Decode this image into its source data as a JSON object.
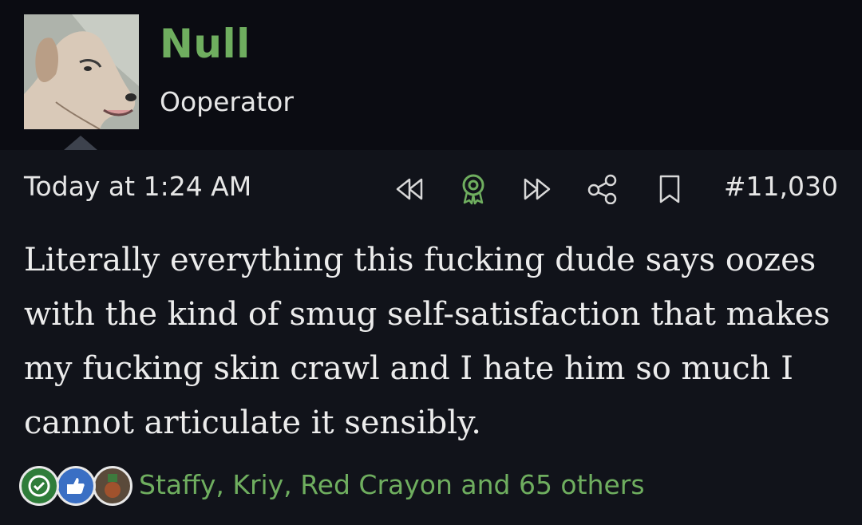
{
  "author": {
    "name": "Null",
    "title": "Ooperator"
  },
  "post": {
    "date": "Today at 1:24 AM",
    "number": "#11,030",
    "body": "Literally everything this fucking dude says oozes with the kind of smug self-satisfaction that makes my fucking skin crawl and I hate him so much I cannot articulate it sensibly."
  },
  "actions": [
    {
      "icon": "rewind-icon"
    },
    {
      "icon": "award-icon"
    },
    {
      "icon": "fast-forward-icon"
    },
    {
      "icon": "share-icon"
    },
    {
      "icon": "bookmark-icon"
    }
  ],
  "reactions": {
    "icons": [
      "check-reaction-icon",
      "thumbs-up-reaction-icon",
      "medal-reaction-icon"
    ],
    "summary": "Staffy, Kriy, Red Crayon and 65 others"
  },
  "colors": {
    "accent": "#6fae5f",
    "background": "#11131a",
    "header_background": "#0b0c12"
  }
}
